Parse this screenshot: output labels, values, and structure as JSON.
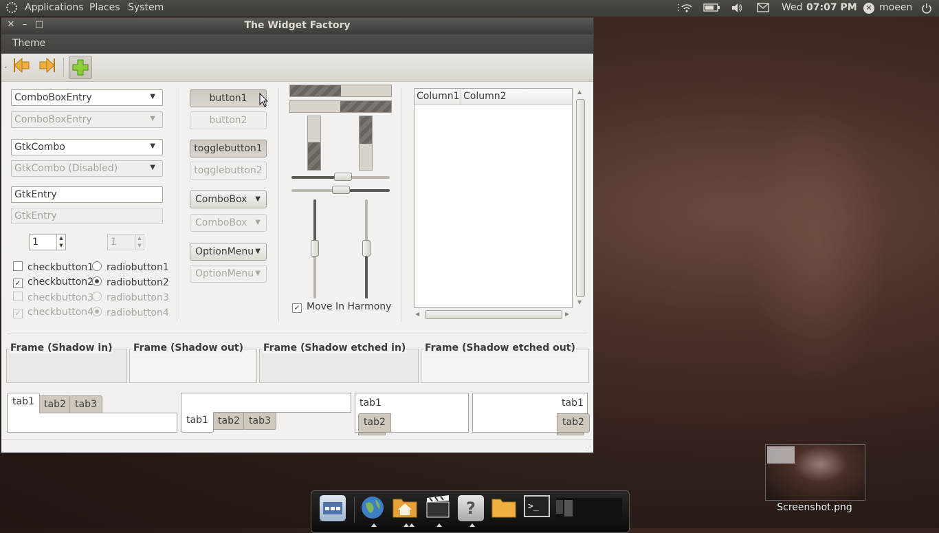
{
  "top_panel": {
    "menus": [
      "Applications",
      "Places",
      "System"
    ],
    "day": "Wed",
    "time": "07:07 PM",
    "user": "moeen"
  },
  "window": {
    "title": "The Widget Factory",
    "menubar": {
      "theme": "Theme"
    }
  },
  "col1": {
    "combo_entry": "ComboBoxEntry",
    "combo_entry_disabled": "ComboBoxEntry",
    "gtk_combo": "GtkCombo",
    "gtk_combo_disabled": "GtkCombo (Disabled)",
    "entry": "GtkEntry",
    "entry_disabled": "GtkEntry",
    "spin_value": "1",
    "spin_disabled_value": "1",
    "checks": [
      "checkbutton1",
      "checkbutton2",
      "checkbutton3",
      "checkbutton4"
    ],
    "radios": [
      "radiobutton1",
      "radiobutton2",
      "radiobutton3",
      "radiobutton4"
    ]
  },
  "col2": {
    "button1": "button1",
    "button2": "button2",
    "toggle1": "togglebutton1",
    "toggle2": "togglebutton2",
    "combobox": "ComboBox",
    "combobox_disabled": "ComboBox",
    "optionmenu": "OptionMenu",
    "optionmenu_disabled": "OptionMenu"
  },
  "col3": {
    "move_in_harmony": "Move In Harmony"
  },
  "tree": {
    "columns": [
      "Column1",
      "Column2"
    ]
  },
  "frames": [
    "Frame (Shadow in)",
    "Frame (Shadow out)",
    "Frame (Shadow etched in)",
    "Frame (Shadow etched out)"
  ],
  "tabs": [
    "tab1",
    "tab2",
    "tab3"
  ],
  "desktop": {
    "screenshot_label": "Screenshot.png"
  },
  "icons": {
    "back": "arrow-left-icon",
    "forward": "arrow-right-icon",
    "add": "plus-icon"
  }
}
